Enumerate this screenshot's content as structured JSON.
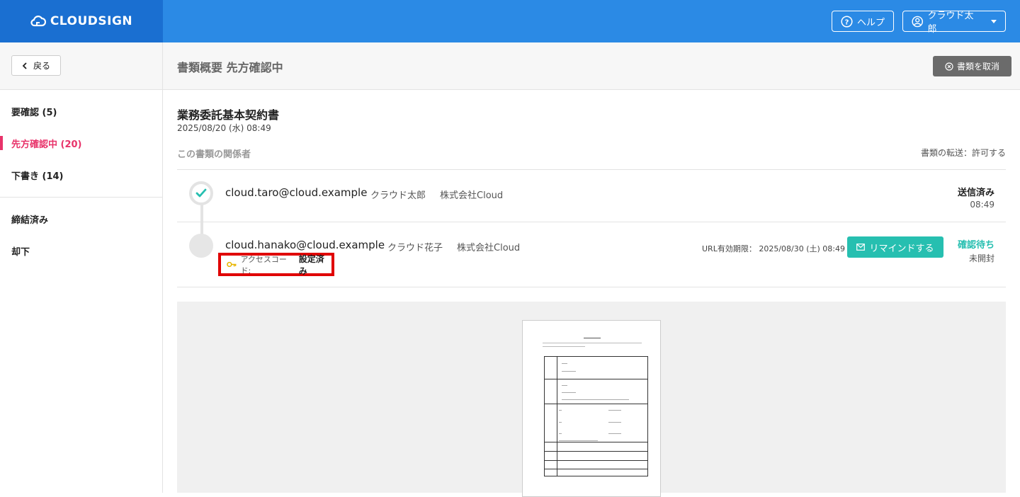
{
  "header": {
    "logo_text": "CLOUDSIGN",
    "help_label": "ヘルプ",
    "user_label": "クラウド太郎"
  },
  "subheader": {
    "back_label": "戻る",
    "title": "書類概要 先方確認中",
    "cancel_label": "書類を取消"
  },
  "sidebar": {
    "items": [
      {
        "label": "要確認 (5)",
        "active": false
      },
      {
        "label": "先方確認中 (20)",
        "active": true
      },
      {
        "label": "下書き (14)",
        "active": false
      },
      {
        "label": "締結済み",
        "active": false
      },
      {
        "label": "却下",
        "active": false
      }
    ]
  },
  "document": {
    "title": "業務委託基本契約書",
    "date": "2025/08/20 (水) 08:49",
    "parties_label": "この書類の関係者",
    "transfer_text": "書類の転送：許可する"
  },
  "parties": [
    {
      "email": "cloud.taro@cloud.example",
      "name": "クラウド太郎",
      "company": "株式会社Cloud",
      "status": "送信済み",
      "status_sub": "08:49"
    },
    {
      "email": "cloud.hanako@cloud.example",
      "name": "クラウド花子",
      "company": "株式会社Cloud",
      "url_expiry": "URL有効期限： 2025/08/30 (土) 08:49",
      "remind_label": "リマインドする",
      "status": "確認待ち",
      "status_sub": "未開封",
      "access_code_label": "アクセスコード:",
      "access_code_value": "設定済み"
    }
  ],
  "colors": {
    "header_bg": "#2b8ae5",
    "logo_bg": "#1a6fd1",
    "accent_pink": "#e8336a",
    "teal": "#26bfb0",
    "highlight_red": "#e00000"
  }
}
